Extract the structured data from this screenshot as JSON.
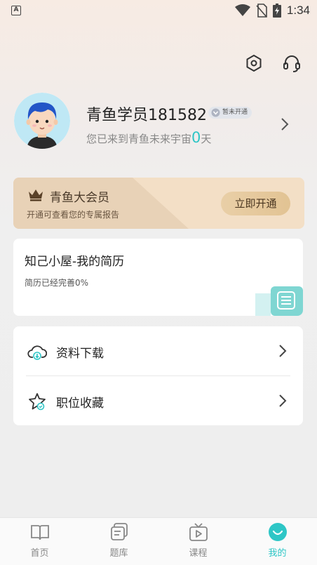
{
  "status_bar": {
    "time": "1:34",
    "left_icon": "A",
    "icons": [
      "wifi-icon",
      "no-sim-icon",
      "battery-charging-icon"
    ]
  },
  "header": {
    "settings_icon": "settings-icon",
    "support_icon": "headset-icon"
  },
  "profile": {
    "username": "青鱼学员181582",
    "vip_status": "暂未开通",
    "sub_prefix": "您已来到青鱼未来宇宙",
    "days": "0",
    "sub_suffix": "天"
  },
  "vip_card": {
    "title": "青鱼大会员",
    "subtitle": "开通可查看您的专属报告",
    "button": "立即开通"
  },
  "resume_card": {
    "title": "知己小屋-我的简历",
    "progress_text": "简历已经完善0%",
    "progress": 0
  },
  "menu": {
    "items": [
      {
        "label": "资料下载",
        "icon": "cloud-download-icon"
      },
      {
        "label": "职位收藏",
        "icon": "star-icon"
      }
    ]
  },
  "tabs": [
    {
      "label": "首页",
      "icon": "book-icon",
      "active": false
    },
    {
      "label": "题库",
      "icon": "question-bank-icon",
      "active": false
    },
    {
      "label": "课程",
      "icon": "tv-icon",
      "active": false
    },
    {
      "label": "我的",
      "icon": "smile-icon",
      "active": true
    }
  ],
  "colors": {
    "accent": "#2ec6c6",
    "vip_gold": "#e8d2b7",
    "text_primary": "#222222",
    "text_secondary": "#888888"
  }
}
